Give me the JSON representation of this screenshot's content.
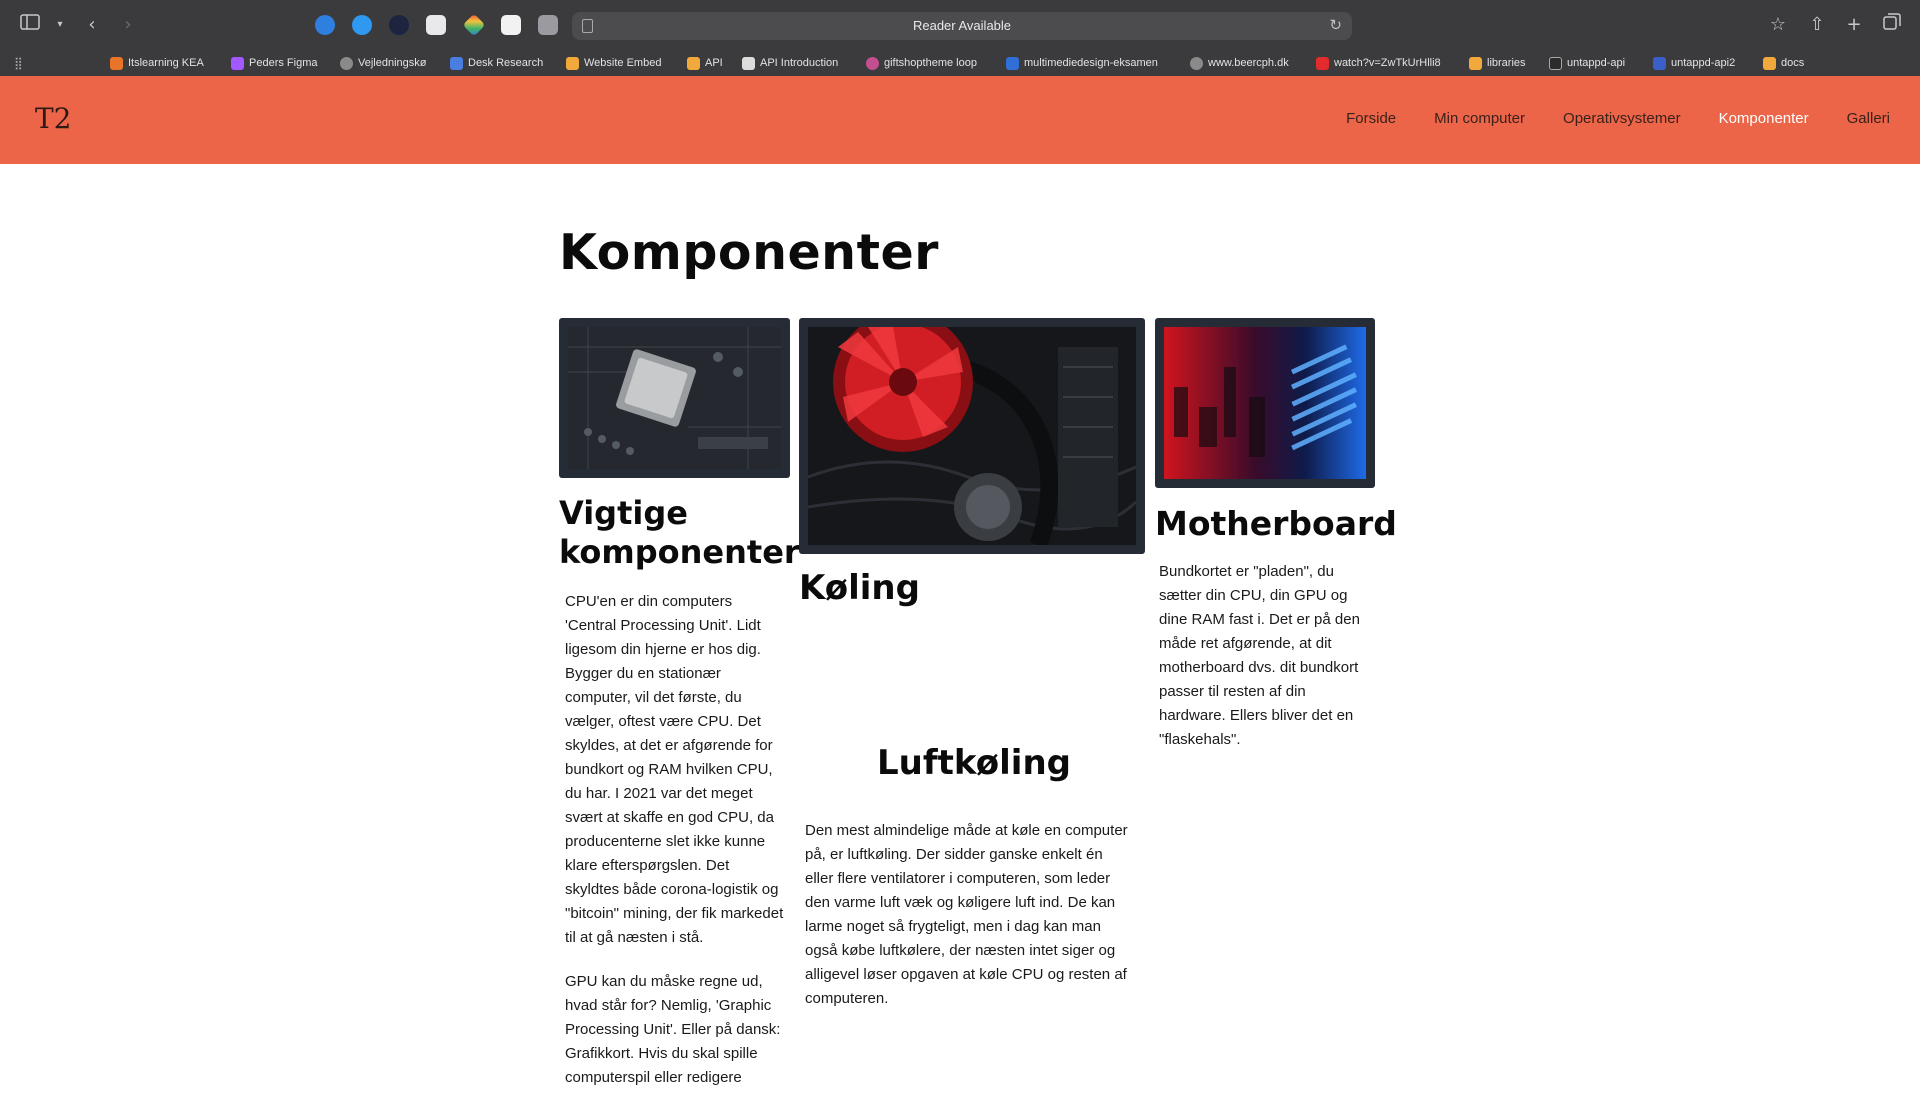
{
  "browser": {
    "address_text": "Reader Available",
    "bookmarks": [
      {
        "label": "Itslearning KEA",
        "color": "#e8742a"
      },
      {
        "label": "Peders Figma",
        "color": "#a259ff"
      },
      {
        "label": "Vejledningskø",
        "color": "#8a8a8a"
      },
      {
        "label": "Desk Research",
        "color": "#4a7de0"
      },
      {
        "label": "Website Embed",
        "color": "#f2a93b"
      },
      {
        "label": "API",
        "color": "#f2a93b"
      },
      {
        "label": "API Introduction",
        "color": "#dcdcdc"
      },
      {
        "label": "giftshoptheme loop",
        "color": "#c44f8f"
      },
      {
        "label": "multimediedesign-eksamen",
        "color": "#2f6fd6"
      },
      {
        "label": "www.beercph.dk",
        "color": "#8a8a8a"
      },
      {
        "label": "watch?v=ZwTkUrHlli8",
        "color": "#e22b2b"
      },
      {
        "label": "libraries",
        "color": "#f2a93b"
      },
      {
        "label": "untappd-api",
        "color": "#2b2b2b"
      },
      {
        "label": "untappd-api2",
        "color": "#3a5fc8"
      },
      {
        "label": "docs",
        "color": "#f2a93b"
      }
    ]
  },
  "site": {
    "logo": "T2",
    "nav": [
      {
        "label": "Forside"
      },
      {
        "label": "Min computer"
      },
      {
        "label": "Operativsystemer"
      },
      {
        "label": "Komponenter"
      },
      {
        "label": "Galleri"
      }
    ],
    "accent": "#ed6548"
  },
  "main": {
    "title": "Komponenter",
    "col1": {
      "heading": "Vigtige komponenter",
      "paragraphs": [
        "CPU'en er din computers 'Central Processing Unit'. Lidt ligesom din hjerne er hos dig. Bygger du en stationær computer, vil det første, du vælger, oftest være CPU. Det skyldes, at det er afgørende for bundkort og RAM hvilken CPU, du har. I 2021 var det meget svært at skaffe en god CPU, da producenterne slet ikke kunne klare efterspørgslen. Det skyldtes både corona-logistik og \"bitcoin\" mining, der fik markedet til at gå næsten i stå.",
        "GPU kan du måske regne ud, hvad står for? Nemlig, 'Graphic Processing Unit'. Eller på dansk: Grafikkort. Hvis du skal spille computerspil eller redigere"
      ]
    },
    "col2": {
      "heading": "Køling",
      "subheading": "Luftkøling",
      "paragraph": "Den mest almindelige måde at køle en computer på, er luftkøling. Der sidder ganske enkelt én eller flere ventilatorer i computeren, som leder den varme luft væk og køligere luft ind. De kan larme noget så frygteligt, men i dag kan man også købe luftkølere, der næsten intet siger og alligevel løser opgaven at køle CPU og resten af computeren."
    },
    "col3": {
      "heading": "Motherboard",
      "paragraph": "Bundkortet er \"pladen\", du sætter din CPU, din GPU og dine RAM fast i. Det er på den måde ret afgørende, at dit motherboard dvs. dit bundkort passer til resten af din hardware. Ellers bliver det en \"flaskehals\"."
    }
  }
}
